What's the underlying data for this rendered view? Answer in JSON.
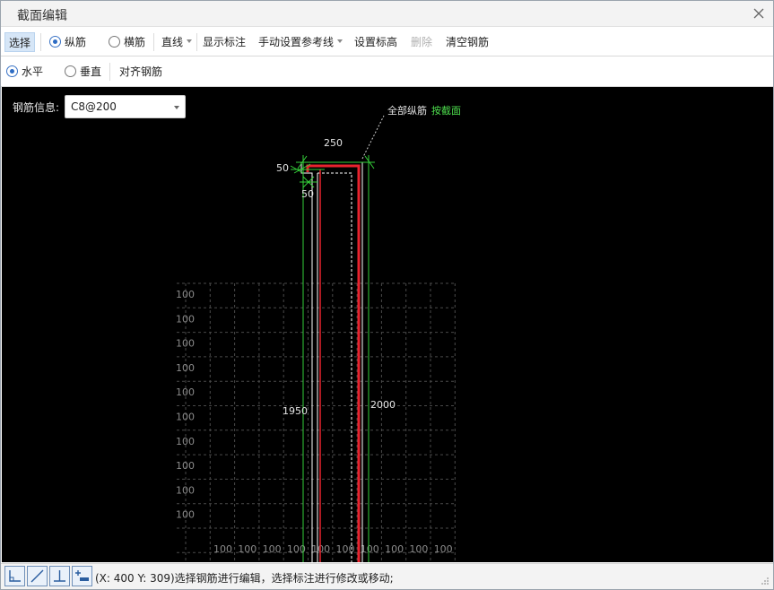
{
  "window": {
    "title": "截面编辑"
  },
  "toolbar1": {
    "select": "选择",
    "longitudinal": "纵筋",
    "transverse": "横筋",
    "line": "直线",
    "show_dims": "显示标注",
    "manual_ref": "手动设置参考线",
    "set_elevation": "设置标高",
    "delete": "删除",
    "clear_rebar": "清空钢筋"
  },
  "toolbar2": {
    "horizontal": "水平",
    "vertical": "垂直",
    "align_rebar": "对齐钢筋"
  },
  "canvas": {
    "rebar_info_label": "钢筋信息:",
    "rebar_info_value": "C8@200",
    "all_longitudinal": "全部纵筋",
    "by_section": "按截面",
    "dim_top": "250",
    "dim_left": "50",
    "dim_corner": "50",
    "dim_1950": "1950",
    "dim_2000": "2000",
    "grid_label": "100",
    "colors": {
      "background": "#000000",
      "rebar": "#e8232e",
      "dimension": "#35d13a",
      "outline": "#ffffff",
      "grid": "#555555",
      "link": "#4ee04e"
    }
  },
  "statusbar": {
    "text": "(X: 400 Y: 309)选择钢筋进行编辑，选择标注进行修改或移动;",
    "icons": [
      "orthogonal-snap-icon",
      "line-snap-icon",
      "perpendicular-snap-icon",
      "point-snap-icon"
    ]
  }
}
